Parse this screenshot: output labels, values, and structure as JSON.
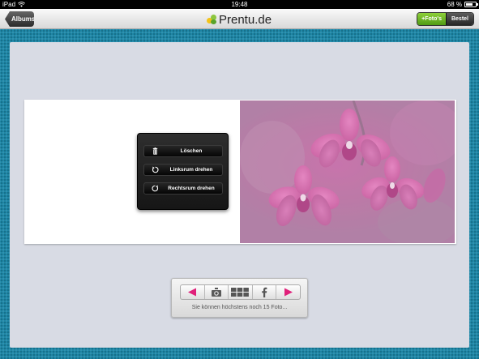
{
  "statusbar": {
    "device": "iPad",
    "time": "19:48",
    "battery": "68 %"
  },
  "navbar": {
    "back_label": "Albums",
    "logo_text": "Prentu.de",
    "foto_label": "+Foto's",
    "bestel_label": "Bestel"
  },
  "popup": {
    "items": [
      {
        "label": "Löschen",
        "icon": "trash-icon"
      },
      {
        "label": "Linksrum drehen",
        "icon": "rotate-left-icon"
      },
      {
        "label": "Rechtsrum drehen",
        "icon": "rotate-right-icon"
      }
    ]
  },
  "toolbar": {
    "buttons": [
      "arrow-left-icon",
      "camera-icon",
      "grid-icon",
      "facebook-icon",
      "arrow-right-icon"
    ],
    "message": "Sie können höchstens noch 15 Foto..."
  },
  "colors": {
    "accent_pink": "#e0207a",
    "frame_teal": "#1d86a6",
    "canvas_gray": "#d8dbe4",
    "green_button": "#6bb528"
  }
}
